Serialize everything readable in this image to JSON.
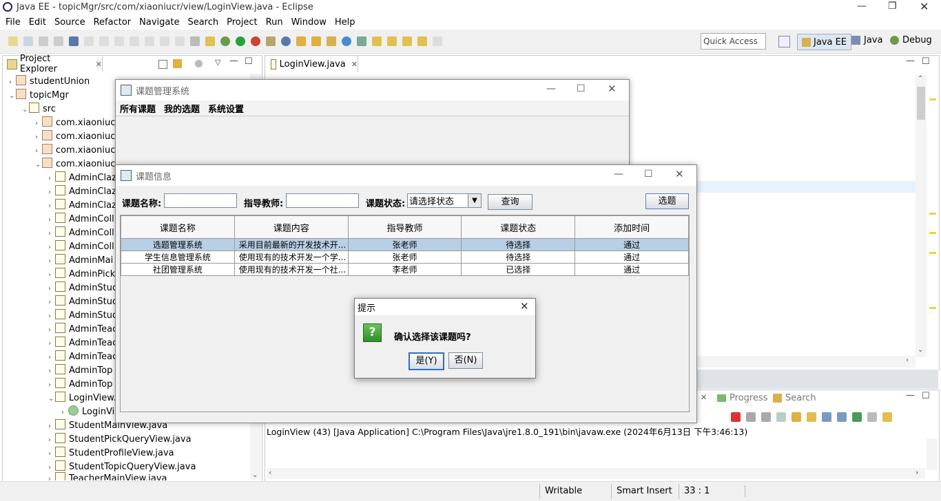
{
  "eclipse": {
    "title": "Java EE - topicMgr/src/com/xiaoniucr/view/LoginView.java - Eclipse",
    "menu": [
      "File",
      "Edit",
      "Source",
      "Refactor",
      "Navigate",
      "Search",
      "Project",
      "Run",
      "Window",
      "Help"
    ],
    "quick_access": "Quick Access",
    "perspectives": [
      "Java EE",
      "Java",
      "Debug"
    ]
  },
  "explorer": {
    "title": "Project Explorer",
    "items": [
      "studentUnion",
      "topicMgr",
      "src",
      "com.xiaoniucr",
      "com.xiaoniucr",
      "com.xiaoniucr",
      "com.xiaoniucr",
      "AdminClaz",
      "AdminClaz",
      "AdminClaz",
      "AdminColl",
      "AdminColl",
      "AdminColl",
      "AdminMai",
      "AdminPick",
      "AdminStud",
      "AdminStud",
      "AdminStud",
      "AdminTeac",
      "AdminTeac",
      "AdminTeac",
      "AdminTop",
      "AdminTop",
      "LoginView.",
      "LoginVi",
      "StudentMainView.java",
      "StudentPickQueryView.java",
      "StudentProfileView.java",
      "StudentTopicQueryView.java",
      "TeacherMainView.java"
    ]
  },
  "editor": {
    "tab": "LoginView.java"
  },
  "console": {
    "tabs": [
      "Progress",
      "Search"
    ],
    "line": "LoginView (43) [Java Application] C:\\Program Files\\Java\\jre1.8.0_191\\bin\\javaw.exe (2024年6月13日 下午3:46:13)"
  },
  "status": {
    "writable": "Writable",
    "insert": "Smart Insert",
    "pos": "33 : 1"
  },
  "mainwin": {
    "title": "课题管理系统",
    "menu": [
      "所有课题",
      "我的选题",
      "系统设置"
    ]
  },
  "topicwin": {
    "title": "课题信息",
    "label_name": "课题名称:",
    "label_teacher": "指导教师:",
    "label_status": "课题状态:",
    "status_select": "请选择状态",
    "query_btn": "查询",
    "select_btn": "选题",
    "columns": [
      "课题名称",
      "课题内容",
      "指导教师",
      "课题状态",
      "添加时间"
    ],
    "rows": [
      [
        "选题管理系统",
        "采用目前最新的开发技术开...",
        "张老师",
        "待选择",
        "通过"
      ],
      [
        "学生信息管理系统",
        "使用现有的技术开发一个学...",
        "张老师",
        "待选择",
        "通过"
      ],
      [
        "社团管理系统",
        "使用现有的技术开发一个社...",
        "李老师",
        "已选择",
        "通过"
      ]
    ]
  },
  "dialog": {
    "title": "提示",
    "message": "确认选择该课题吗?",
    "yes": "是(Y)",
    "no": "否(N)",
    "icon_glyph": "?"
  }
}
